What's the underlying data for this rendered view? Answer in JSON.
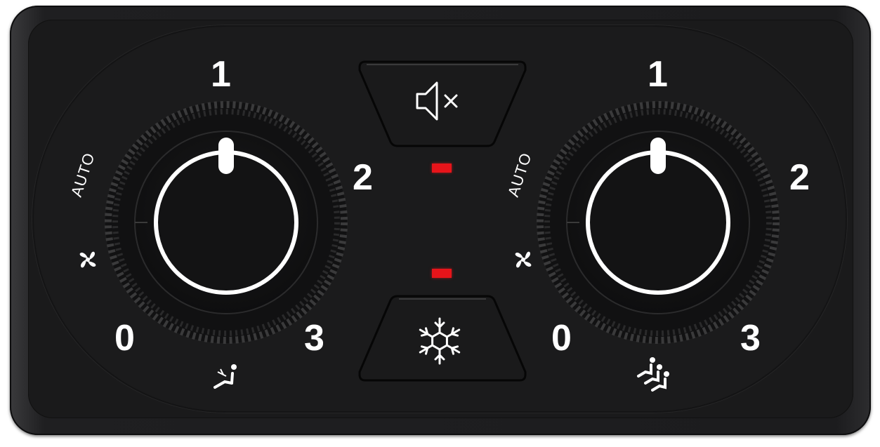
{
  "panel": {
    "left_knob": {
      "positions": {
        "zero": "0",
        "one": "1",
        "two": "2",
        "three": "3"
      },
      "auto_label": "AUTO",
      "fan_icon": "fan-icon",
      "bottom_icon": "seat-recline-icon"
    },
    "right_knob": {
      "positions": {
        "zero": "0",
        "one": "1",
        "two": "2",
        "three": "3"
      },
      "auto_label": "AUTO",
      "fan_icon": "fan-icon",
      "bottom_icon": "multi-seat-icon"
    },
    "mute_button": {
      "icon": "speaker-mute-icon"
    },
    "ac_button": {
      "icon": "snowflake-icon"
    },
    "indicators": {
      "top_led_color": "#e8141a",
      "bottom_led_color": "#e8141a"
    }
  }
}
